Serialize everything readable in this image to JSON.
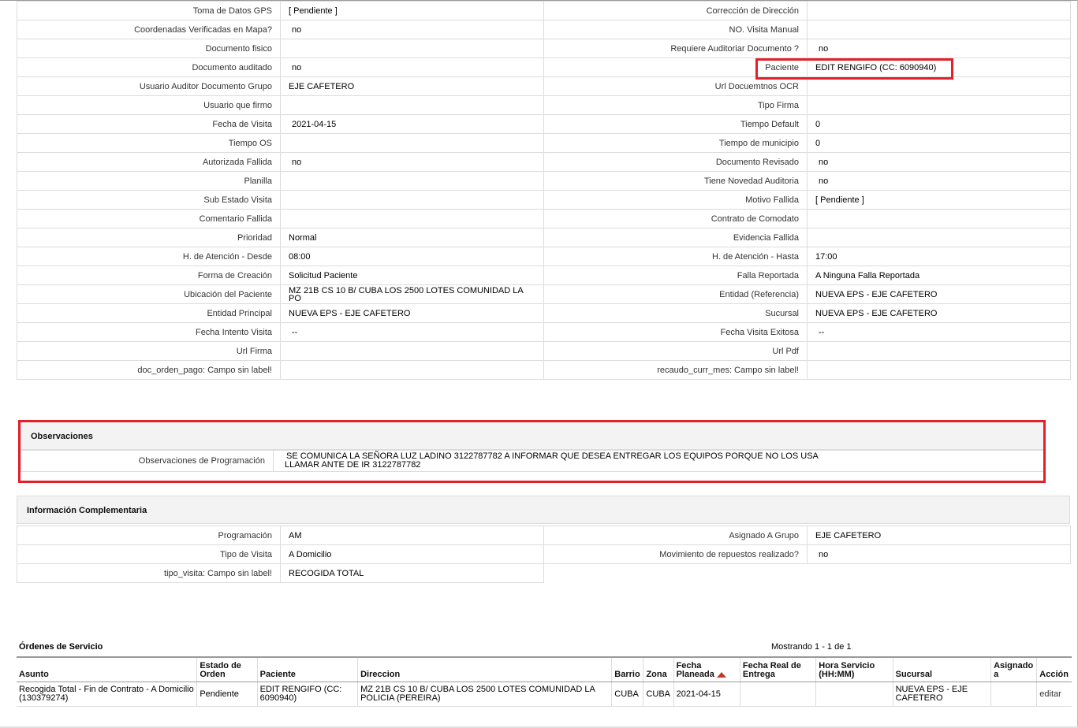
{
  "details": [
    {
      "l1": "Toma de Datos GPS",
      "v1": "[ Pendiente ]",
      "l2": "Corrección de Dirección",
      "v2": ""
    },
    {
      "l1": "Coordenadas Verificadas en Mapa?",
      "v1": "no",
      "l2": "NO. Visita Manual",
      "v2": ""
    },
    {
      "l1": "Documento fisico",
      "v1": "",
      "l2": "Requiere Auditoriar Documento ?",
      "v2": "no"
    },
    {
      "l1": "Documento auditado",
      "v1": "no",
      "l2": "Paciente",
      "v2": "EDIT RENGIFO (CC: 6090940)"
    },
    {
      "l1": "Usuario Auditor Documento Grupo",
      "v1": "EJE CAFETERO",
      "l2": "Url Docuemtnos OCR",
      "v2": ""
    },
    {
      "l1": "Usuario que firmo",
      "v1": "",
      "l2": "Tipo Firma",
      "v2": ""
    },
    {
      "l1": "Fecha de Visita",
      "v1": "2021-04-15",
      "l2": "Tiempo Default",
      "v2": "0"
    },
    {
      "l1": "Tiempo OS",
      "v1": "",
      "l2": "Tiempo de municipio",
      "v2": "0"
    },
    {
      "l1": "Autorizada Fallida",
      "v1": "no",
      "l2": "Documento Revisado",
      "v2": "no"
    },
    {
      "l1": "Planilla",
      "v1": "",
      "l2": "Tiene Novedad Auditoria",
      "v2": "no"
    },
    {
      "l1": "Sub Estado Visita",
      "v1": "",
      "l2": "Motivo Fallida",
      "v2": "[ Pendiente ]"
    },
    {
      "l1": "Comentario Fallida",
      "v1": "",
      "l2": "Contrato de Comodato",
      "v2": ""
    },
    {
      "l1": "Prioridad",
      "v1": "Normal",
      "l2": "Evidencia Fallida",
      "v2": ""
    },
    {
      "l1": "H. de Atención - Desde",
      "v1": "08:00",
      "l2": "H. de Atención - Hasta",
      "v2": "17:00"
    },
    {
      "l1": "Forma de Creación",
      "v1": "Solicitud Paciente",
      "l2": "Falla Reportada",
      "v2": "A Ninguna Falla Reportada"
    },
    {
      "l1": "Ubicación del Paciente",
      "v1": "MZ 21B CS 10 B/ CUBA LOS 2500 LOTES COMUNIDAD LA PO",
      "l2": "Entidad (Referencia)",
      "v2": "NUEVA EPS - EJE CAFETERO"
    },
    {
      "l1": "Entidad Principal",
      "v1": "NUEVA EPS - EJE CAFETERO",
      "l2": "Sucursal",
      "v2": "NUEVA EPS - EJE CAFETERO"
    },
    {
      "l1": "Fecha Intento Visita",
      "v1": "--",
      "l2": "Fecha Visita Exitosa",
      "v2": "--"
    },
    {
      "l1": "Url Firma",
      "v1": "",
      "l2": "Url Pdf",
      "v2": ""
    },
    {
      "l1": "doc_orden_pago: Campo sin label!",
      "v1": "",
      "l2": "recaudo_curr_mes: Campo sin label!",
      "v2": ""
    }
  ],
  "observaciones": {
    "title": "Observaciones",
    "label": "Observaciones de Programación",
    "line1": "SE COMUNICA LA SEÑORA LUZ LADINO 3122787782 A INFORMAR QUE DESEA ENTREGAR LOS EQUIPOS PORQUE NO LOS USA",
    "line2": "LLAMAR ANTE DE IR 3122787782"
  },
  "complementaria": {
    "title": "Información Complementaria",
    "rows": [
      {
        "l1": "Programación",
        "v1": "AM",
        "l2": "Asignado A Grupo",
        "v2": "EJE CAFETERO"
      },
      {
        "l1": "Tipo de Visita",
        "v1": "A Domicilio",
        "l2": "Movimiento de repuestos realizado?",
        "v2": "no"
      },
      {
        "l1": "tipo_visita: Campo sin label!",
        "v1": "RECOGIDA TOTAL"
      }
    ]
  },
  "ordenes": {
    "title": "Órdenes de Servicio",
    "count": "Mostrando 1 - 1 de 1",
    "columns": [
      "Asunto",
      "Estado de Orden",
      "Paciente",
      "Direccion",
      "Barrio",
      "Zona",
      "Fecha Planeada",
      "Fecha Real de Entrega",
      "Hora Servicio (HH:MM)",
      "Sucursal",
      "Asignado a",
      "Acción"
    ],
    "rows": [
      {
        "asunto": "Recogida Total - Fin de Contrato - A Domicilio (130379274)",
        "estado": "Pendiente",
        "paciente": "EDIT RENGIFO (CC: 6090940)",
        "direccion": "MZ 21B CS 10 B/ CUBA LOS 2500 LOTES COMUNIDAD LA POLICIA (PEREIRA)",
        "barrio": "CUBA",
        "zona": "CUBA",
        "fecha_planeada": "2021-04-15",
        "fecha_real": "",
        "hora": "",
        "sucursal": "NUEVA EPS - EJE CAFETERO",
        "asignado": "",
        "accion": "editar"
      }
    ],
    "sort_color": "#c0392b"
  },
  "highlight_color": "#e3202a"
}
